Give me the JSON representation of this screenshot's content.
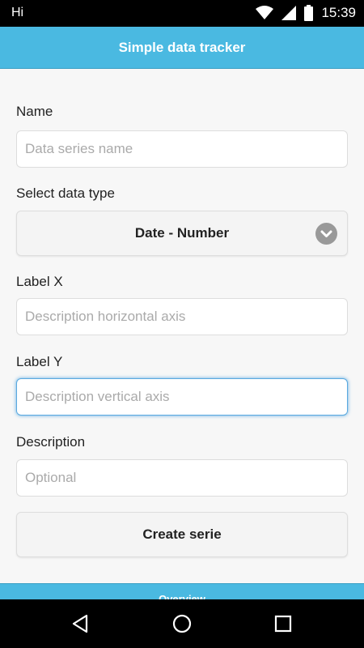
{
  "status_bar": {
    "carrier": "Hi",
    "time": "15:39"
  },
  "header": {
    "title": "Simple data tracker"
  },
  "form": {
    "name": {
      "label": "Name",
      "placeholder": "Data series name",
      "value": ""
    },
    "data_type": {
      "label": "Select data type",
      "selected": "Date - Number"
    },
    "label_x": {
      "label": "Label X",
      "placeholder": "Description horizontal axis",
      "value": ""
    },
    "label_y": {
      "label": "Label Y",
      "placeholder": "Description vertical axis",
      "value": ""
    },
    "description": {
      "label": "Description",
      "placeholder": "Optional",
      "value": ""
    },
    "create_button": "Create serie"
  },
  "footer": {
    "tab_label": "Overview"
  },
  "colors": {
    "accent": "#4ab9e1",
    "focus": "#5aa9e0",
    "background": "#f7f7f7"
  },
  "icons": {
    "status": [
      "wifi-icon",
      "signal-icon",
      "battery-icon"
    ],
    "navigation": [
      "back-icon",
      "home-icon",
      "recents-icon"
    ],
    "select": "chevron-down-icon"
  }
}
